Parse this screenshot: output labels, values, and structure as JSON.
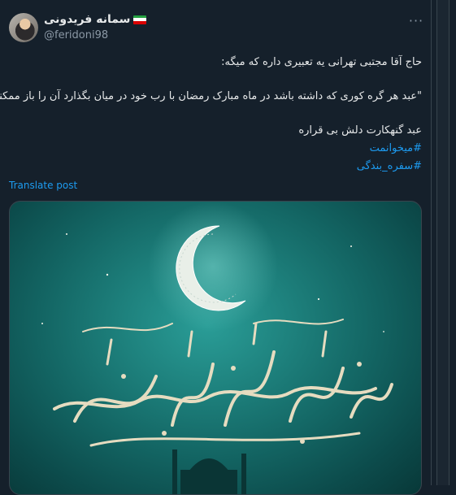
{
  "author": {
    "display_name": "سمانه فریدونی",
    "handle": "@feridoni98"
  },
  "menu": {
    "more_label": "···"
  },
  "tweet": {
    "line1": "حاج آقا مجتبی تهرانی یه تعبیری داره که میگه:",
    "line2": "\"عبد هر گره کوری که داشته باشد در ماه مبارک رمضان با رب خود در میان بگذارد آن را باز ممکند\"",
    "line3": "عبد گنهکارت دلش بی قراره",
    "hashtag1": "#میخوانمت",
    "hashtag2": "#سفره_بندگی"
  },
  "translate_label": "Translate post",
  "media": {
    "calligraphy": "شهر رمضان الذی أنزل فیه القرآن"
  },
  "colors": {
    "background": "#15202b",
    "text": "#e7e9ea",
    "muted": "#8b98a5",
    "link": "#1d9bf0",
    "border": "#38444d",
    "image_teal": "#1d7f7b",
    "calligraphy_gold": "#e6dcc0"
  }
}
